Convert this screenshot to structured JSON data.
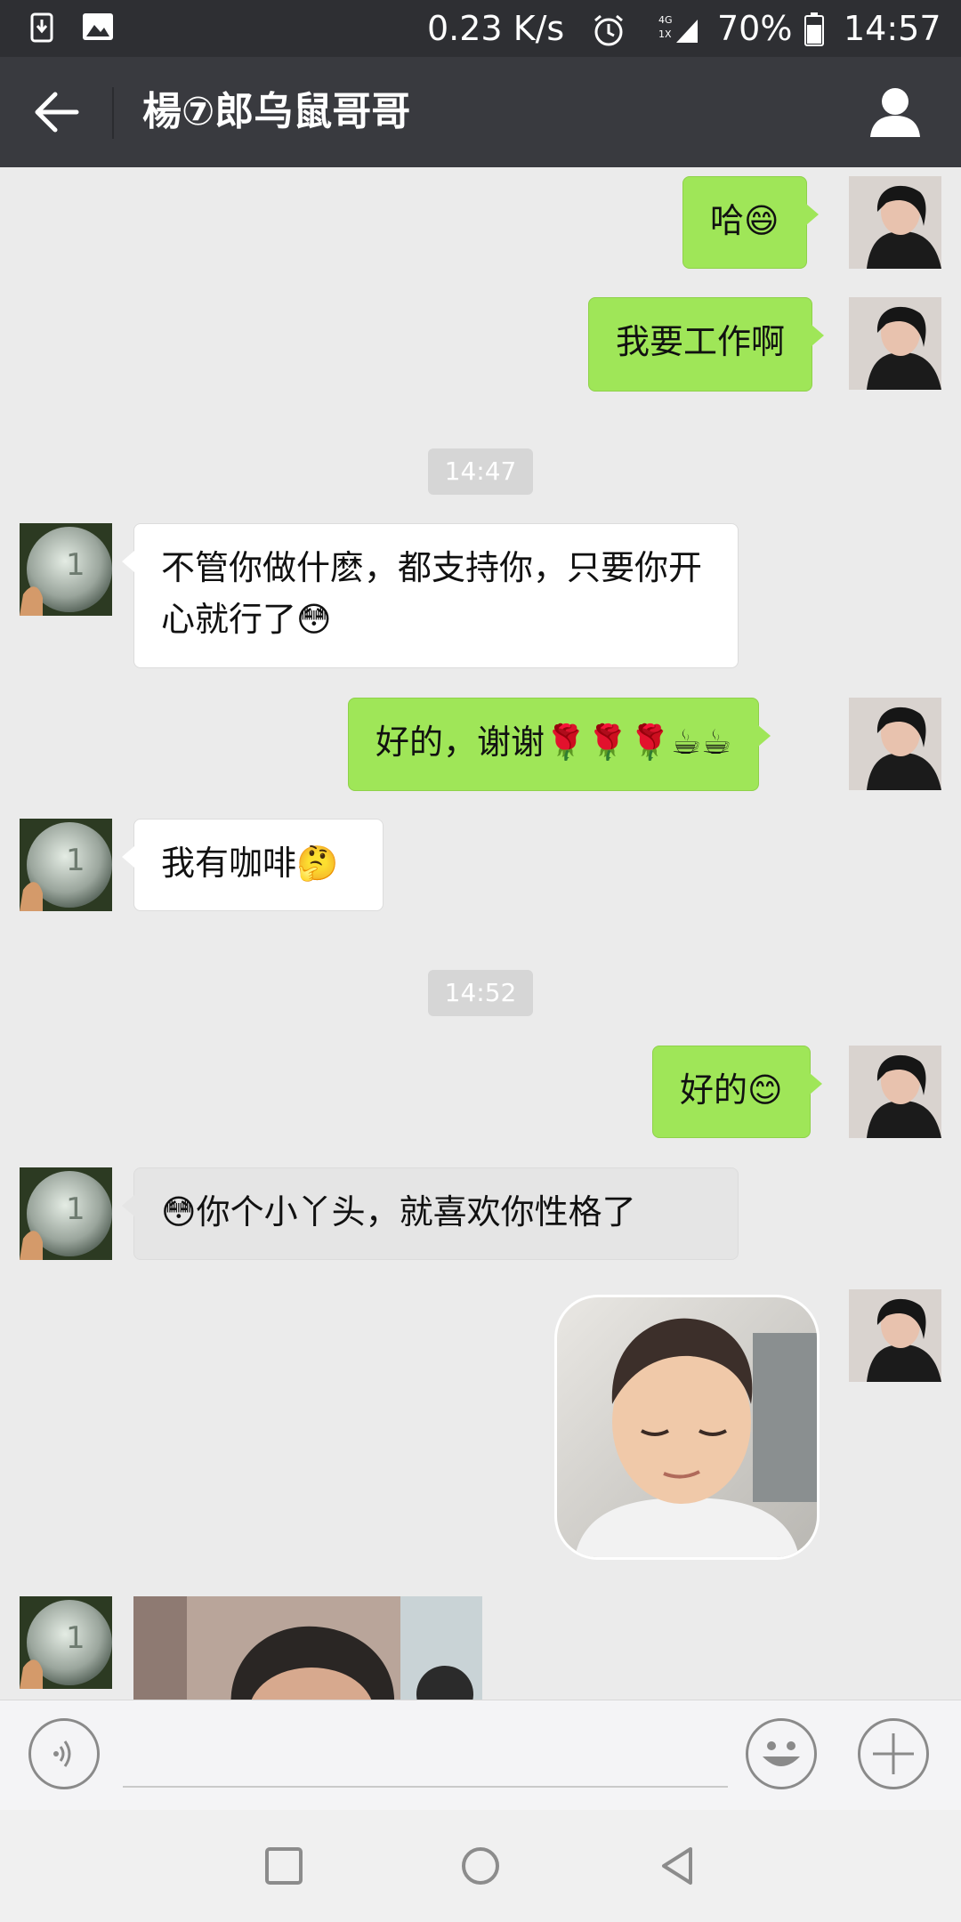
{
  "status_bar": {
    "net_speed": "0.23 K/s",
    "network": "4G",
    "battery": "70%",
    "time": "14:57"
  },
  "header": {
    "title": "楊⑦郎乌鼠哥哥"
  },
  "timestamps": [
    "14:47",
    "14:52"
  ],
  "messages": [
    {
      "side": "mine",
      "text": "哈😄"
    },
    {
      "side": "mine",
      "text": "我要工作啊"
    },
    {
      "side": "theirs",
      "text": "不管你做什麽，都支持你，只要你开心就行了😳"
    },
    {
      "side": "mine",
      "text": "好的，谢谢🌹🌹🌹☕☕"
    },
    {
      "side": "theirs",
      "text": "我有咖啡🤔"
    },
    {
      "side": "mine",
      "text": "好的😊"
    },
    {
      "side": "theirs",
      "text": "😳你个小丫头，就喜欢你性格了"
    },
    {
      "side": "mine",
      "type": "sticker"
    },
    {
      "side": "theirs",
      "type": "photo"
    }
  ],
  "input": {
    "value": "",
    "placeholder": ""
  },
  "icons": {
    "back": "arrow-left-icon",
    "profile": "person-icon",
    "voice": "voice-icon",
    "emoji": "emoji-icon",
    "more": "plus-icon"
  },
  "colors": {
    "my_bubble": "#9fe658",
    "their_bubble": "#ffffff",
    "header_bg": "#393a3f",
    "status_bg": "#2e2f33"
  }
}
